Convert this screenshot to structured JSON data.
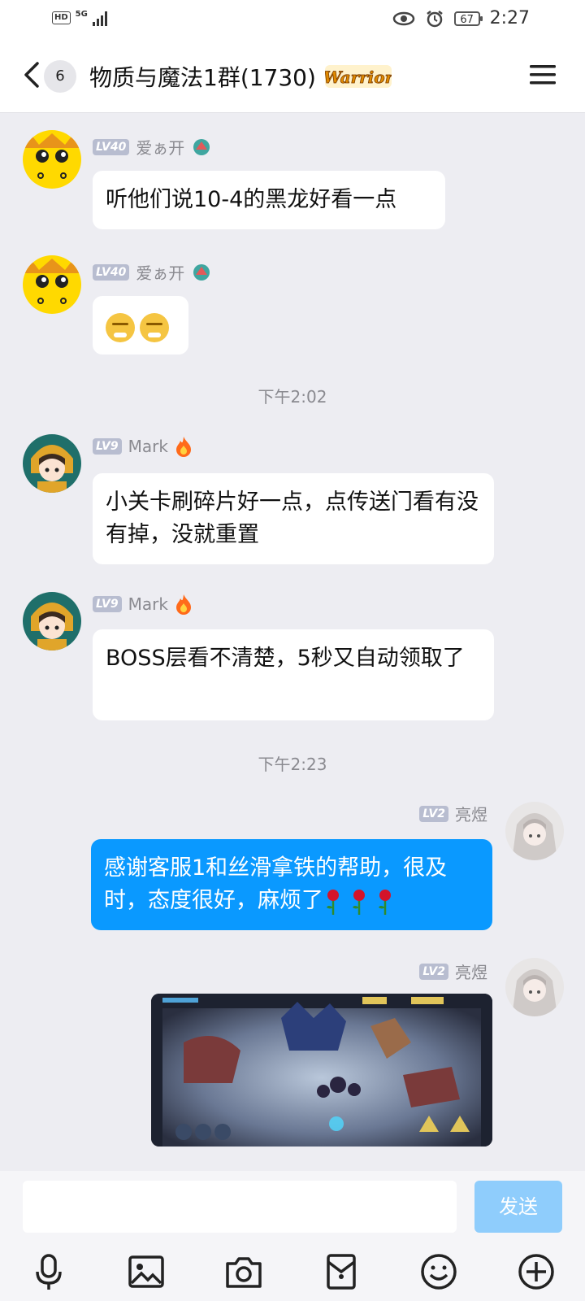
{
  "status": {
    "network": "5G",
    "hd": "HD",
    "battery": "67",
    "time": "2:27"
  },
  "header": {
    "unread_count": "6",
    "title": "物质与魔法1群(1730)",
    "badge": "Warrior"
  },
  "messages": [
    {
      "level": "LV40",
      "name": "爱ぁ开",
      "text": "听他们说10-4的黑龙好看一点"
    },
    {
      "level": "LV40",
      "name": "爱ぁ开"
    },
    {
      "level": "LV9",
      "name": "Mark",
      "text": "小关卡刷碎片好一点，点传送门看有没有掉，没就重置"
    },
    {
      "level": "LV9",
      "name": "Mark",
      "text": "BOSS层看不清楚，5秒又自动领取了"
    },
    {
      "level": "LV2",
      "name": "亮煜",
      "text": "感谢客服1和丝滑拿铁的帮助，很及时，态度很好，麻烦了"
    },
    {
      "level": "LV2",
      "name": "亮煜"
    }
  ],
  "times": [
    "下午2:02",
    "下午2:23"
  ],
  "input": {
    "send_label": "发送",
    "value": ""
  },
  "colors": {
    "self_bubble": "#0a99ff",
    "send_disabled": "#8fcdfc",
    "background": "#ededf2"
  }
}
